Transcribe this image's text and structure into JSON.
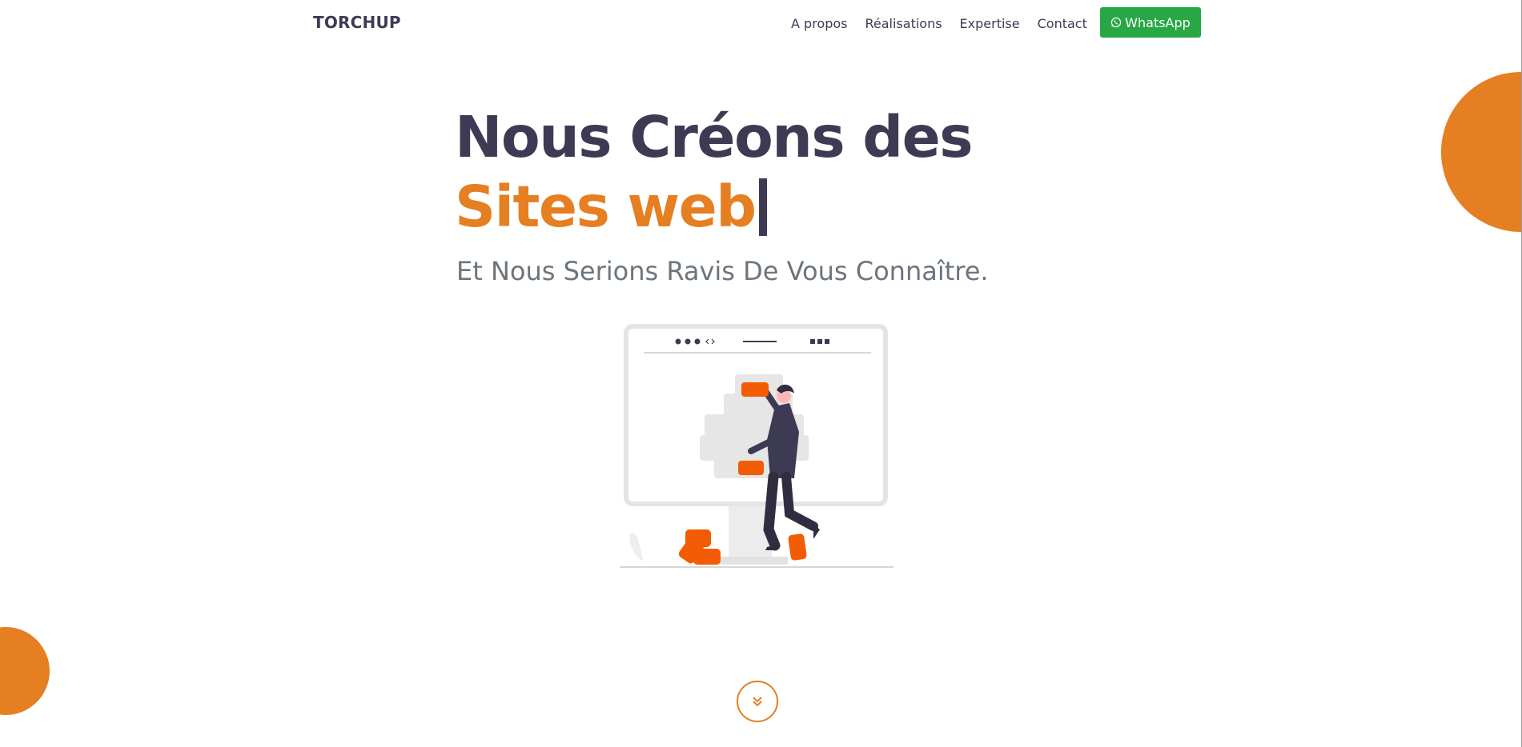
{
  "nav": {
    "brand": "TORCHUP",
    "links": [
      "A propos",
      "Réalisations",
      "Expertise",
      "Contact"
    ],
    "whatsapp_label": "WhatsApp"
  },
  "hero": {
    "line1": "Nous Créons des",
    "line2": "Sites web",
    "subtitle": "Et Nous Serions Ravis De Vous Connaître."
  },
  "icons": {
    "whatsapp": "whatsapp-icon",
    "scroll_down": "double-chevron-down-icon",
    "illustration": "web-builder-illustration"
  },
  "colors": {
    "primary_dark": "#3d3b54",
    "accent_orange": "#e67e22",
    "whatsapp_green": "#28a745",
    "muted_text": "#6c757d"
  }
}
